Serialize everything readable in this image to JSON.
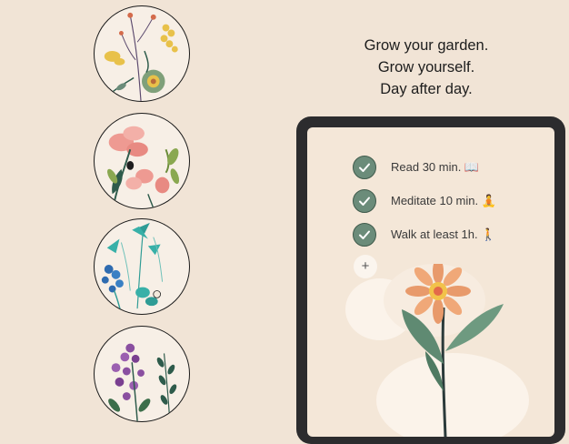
{
  "tagline": [
    "Grow your garden.",
    "Grow yourself.",
    "Day after day."
  ],
  "habits": [
    {
      "label": "Read 30 min. 📖",
      "done": true
    },
    {
      "label": "Meditate 10 min. 🧘",
      "done": true
    },
    {
      "label": "Walk at least 1h. 🚶",
      "done": true
    }
  ],
  "add_button": "+",
  "icons": {
    "check": "checkmark-icon",
    "add": "plus-icon"
  },
  "colors": {
    "background": "#f1e4d6",
    "check_fill": "#6b8c7a",
    "device": "#2c2c2e",
    "flower": "#e89a6b"
  }
}
